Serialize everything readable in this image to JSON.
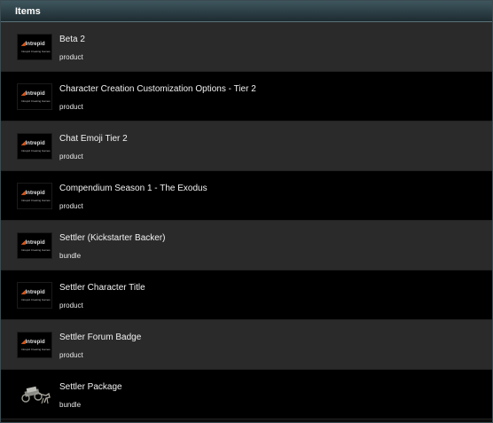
{
  "header": {
    "title": "Items"
  },
  "logo": {
    "word": "Intrepid",
    "tagline": "Intrepid Creating Games"
  },
  "items": [
    {
      "name": "Beta 2",
      "type": "product",
      "icon": "intrepid-logo-icon"
    },
    {
      "name": "Character Creation Customization Options - Tier 2",
      "type": "product",
      "icon": "intrepid-logo-icon"
    },
    {
      "name": "Chat Emoji Tier 2",
      "type": "product",
      "icon": "intrepid-logo-icon"
    },
    {
      "name": "Compendium Season 1 - The Exodus",
      "type": "product",
      "icon": "intrepid-logo-icon"
    },
    {
      "name": "Settler (Kickstarter Backer)",
      "type": "bundle",
      "icon": "intrepid-logo-icon"
    },
    {
      "name": "Settler Character Title",
      "type": "product",
      "icon": "intrepid-logo-icon"
    },
    {
      "name": "Settler Forum Badge",
      "type": "product",
      "icon": "intrepid-logo-icon"
    },
    {
      "name": "Settler Package",
      "type": "bundle",
      "icon": "wagon-icon"
    }
  ]
}
